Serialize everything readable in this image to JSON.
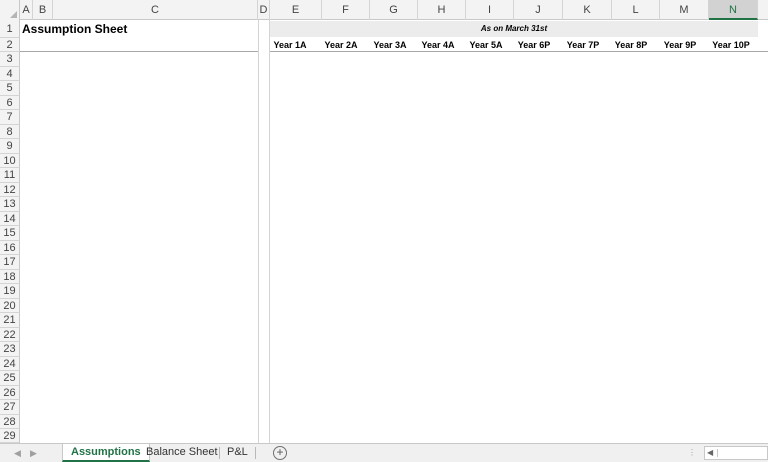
{
  "sheet": {
    "title": "Assumption Sheet",
    "banner": "As on March 31st"
  },
  "columns": [
    "A",
    "B",
    "C",
    "D",
    "E",
    "F",
    "G",
    "H",
    "I",
    "J",
    "K",
    "L",
    "M",
    "N"
  ],
  "rows": [
    "1",
    "2",
    "3",
    "4",
    "5",
    "6",
    "7",
    "8",
    "9",
    "10",
    "11",
    "12",
    "13",
    "14",
    "15",
    "16",
    "17",
    "18",
    "19",
    "20",
    "21",
    "22",
    "23",
    "24",
    "25",
    "26",
    "27",
    "28",
    "29"
  ],
  "years": [
    "Year 1A",
    "Year 2A",
    "Year 3A",
    "Year 4A",
    "Year 5A",
    "Year 6P",
    "Year 7P",
    "Year 8P",
    "Year 9P",
    "Year 10P"
  ],
  "selected_column": "N",
  "tabs": [
    {
      "label": "Assumptions",
      "active": true
    },
    {
      "label": "Balance Sheet",
      "active": false
    },
    {
      "label": "P&L",
      "active": false
    }
  ],
  "icons": {
    "add_sheet": "plus-circle-icon",
    "nav_prev": "chevron-left-icon",
    "nav_next": "chevron-right-icon"
  },
  "colors": {
    "accent": "#217346",
    "header_bg": "#f3f3f3",
    "banner_bg": "#ececec"
  }
}
